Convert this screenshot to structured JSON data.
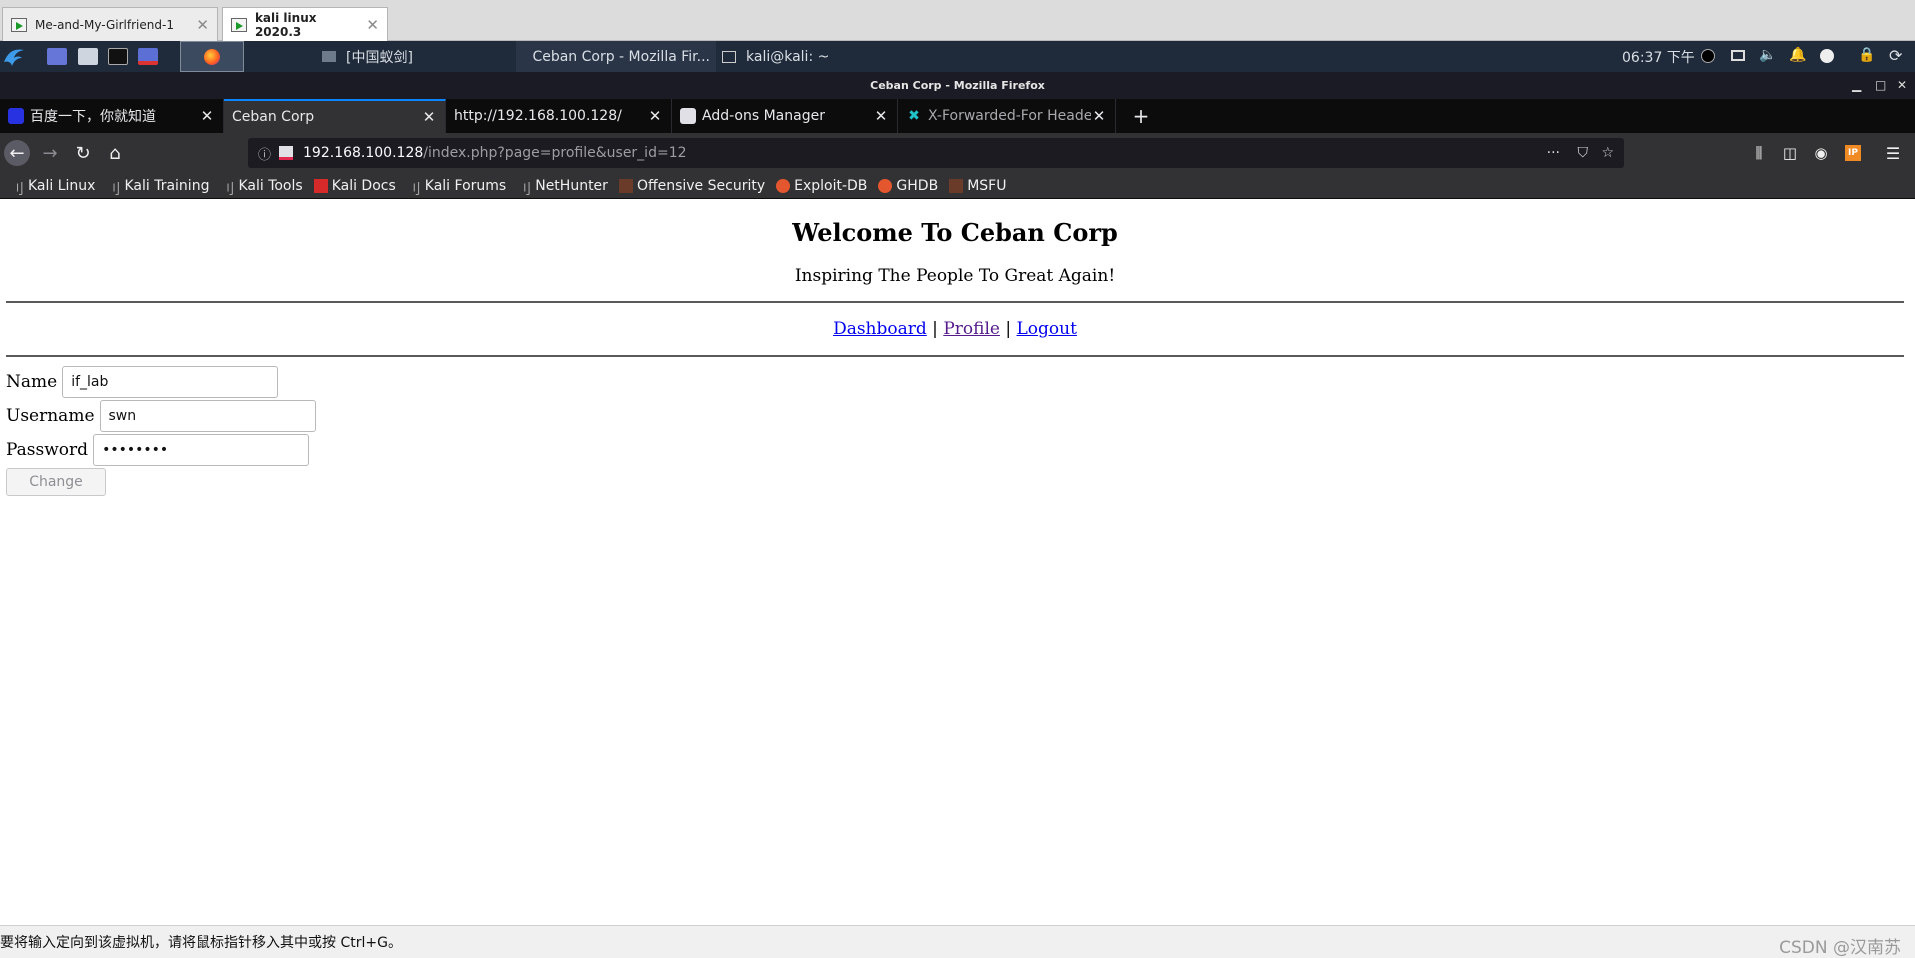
{
  "vm_tabs": [
    {
      "label": "Me-and-My-Girlfriend-1"
    },
    {
      "label": "kali linux 2020.3"
    }
  ],
  "panel": {
    "tasks": [
      {
        "label": "[中国蚁剑]"
      },
      {
        "label": "Ceban Corp - Mozilla Fir..."
      },
      {
        "label": "kali@kali: ~"
      }
    ],
    "clock": "06:37 下午"
  },
  "window_title": "Ceban Corp - Mozilla Firefox",
  "browser_tabs": [
    {
      "label": "百度一下，你就知道"
    },
    {
      "label": "Ceban Corp"
    },
    {
      "label": "http://192.168.100.128/"
    },
    {
      "label": "Add-ons Manager"
    },
    {
      "label": "X-Forwarded-For Heade"
    }
  ],
  "url": {
    "host": "192.168.100.128",
    "path": "/index.php?page=profile&user_id=12"
  },
  "bookmarks": [
    {
      "label": "Kali Linux"
    },
    {
      "label": "Kali Training"
    },
    {
      "label": "Kali Tools"
    },
    {
      "label": "Kali Docs"
    },
    {
      "label": "Kali Forums"
    },
    {
      "label": "NetHunter"
    },
    {
      "label": "Offensive Security"
    },
    {
      "label": "Exploit-DB"
    },
    {
      "label": "GHDB"
    },
    {
      "label": "MSFU"
    }
  ],
  "page": {
    "title": "Welcome To Ceban Corp",
    "subtitle": "Inspiring The People To Great Again!",
    "nav": {
      "dashboard": "Dashboard",
      "sep": "|",
      "profile": "Profile",
      "logout": "Logout"
    },
    "form": {
      "name_label": "Name",
      "name_value": "if_lab",
      "username_label": "Username",
      "username_value": "swn",
      "password_label": "Password",
      "password_value": "password",
      "submit_label": "Change"
    }
  },
  "status": {
    "hint": "要将输入定向到该虚拟机，请将鼠标指针移入其中或按 Ctrl+G。",
    "watermark": "CSDN @汉南苏"
  },
  "colors": {
    "accent": "#0a84ff",
    "panel": "#1f2b3a",
    "link": "#0000ee",
    "visited": "#551a8b"
  }
}
